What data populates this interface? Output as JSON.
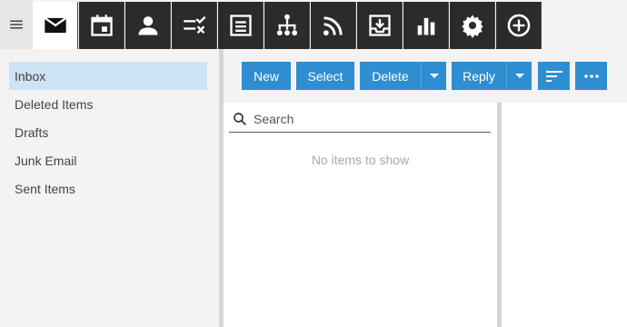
{
  "appbar": {
    "tiles": [
      {
        "name": "mail-icon",
        "active": true
      },
      {
        "name": "calendar-icon"
      },
      {
        "name": "contacts-icon"
      },
      {
        "name": "tasks-icon"
      },
      {
        "name": "notes-icon"
      },
      {
        "name": "org-chart-icon"
      },
      {
        "name": "rss-icon"
      },
      {
        "name": "inbox-download-icon"
      },
      {
        "name": "reports-chart-icon"
      },
      {
        "name": "settings-gear-icon"
      },
      {
        "name": "add-circle-icon"
      }
    ]
  },
  "folders": [
    {
      "label": "Inbox",
      "selected": true
    },
    {
      "label": "Deleted Items"
    },
    {
      "label": "Drafts"
    },
    {
      "label": "Junk Email"
    },
    {
      "label": "Sent Items"
    }
  ],
  "toolbar": {
    "new_label": "New",
    "select_label": "Select",
    "delete_label": "Delete",
    "reply_label": "Reply"
  },
  "search": {
    "placeholder": "Search"
  },
  "list": {
    "empty_text": "No items to show"
  },
  "colors": {
    "accent": "#2f8ed1",
    "selected_folder": "#cde4f4",
    "appbar_dark": "#2b2b2b"
  }
}
